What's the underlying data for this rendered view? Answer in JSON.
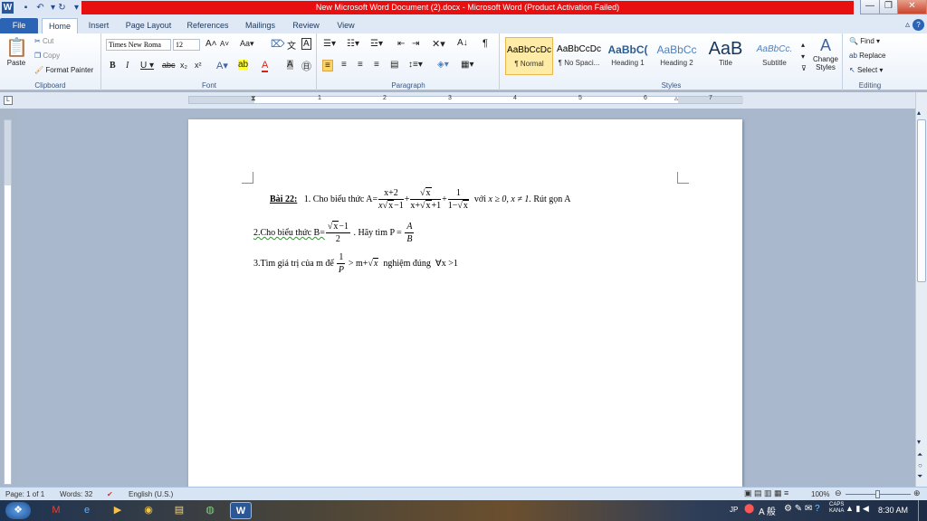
{
  "window": {
    "title": "New Microsoft Word Document (2).docx  -  Microsoft Word (Product Activation Failed)",
    "minimize": "—",
    "restore": "❐",
    "close": "✕"
  },
  "tabs": {
    "file": "File",
    "items": [
      "Home",
      "Insert",
      "Page Layout",
      "References",
      "Mailings",
      "Review",
      "View"
    ],
    "active": "Home"
  },
  "ribbon": {
    "clipboard": {
      "label": "Clipboard",
      "paste": "Paste",
      "cut": "Cut",
      "copy": "Copy",
      "format_painter": "Format Painter"
    },
    "font": {
      "label": "Font",
      "font_name": "Times New Roma",
      "font_size": "12"
    },
    "paragraph": {
      "label": "Paragraph"
    },
    "styles": {
      "label": "Styles",
      "items": [
        {
          "preview": "AaBbCcDc",
          "name": "¶ Normal"
        },
        {
          "preview": "AaBbCcDc",
          "name": "¶ No Spaci..."
        },
        {
          "preview": "AaBbC(",
          "name": "Heading 1"
        },
        {
          "preview": "AaBbCc",
          "name": "Heading 2"
        },
        {
          "preview": "AaB",
          "name": "Title"
        },
        {
          "preview": "AaBbCc.",
          "name": "Subtitle"
        }
      ],
      "change_styles": "Change Styles"
    },
    "editing": {
      "label": "Editing",
      "find": "Find",
      "replace": "Replace",
      "select": "Select"
    }
  },
  "ruler": {
    "numbers": [
      "1",
      "1",
      "2",
      "3",
      "4",
      "5",
      "6",
      "7"
    ]
  },
  "document": {
    "line1": {
      "heading": "Bài 22:",
      "text1": "1. Cho biểu thức A=",
      "f1_num": "x+2",
      "f1_den_a": "x",
      "f1_den_root": "x",
      "f1_den_b": "−1",
      "plus": "+",
      "f2_num_root": "x",
      "f2_den_a": "x+",
      "f2_den_root": "x",
      "f2_den_b": "+1",
      "f3_num": "1",
      "f3_den_a": "1−",
      "f3_den_root": "x",
      "text2": "với",
      "cond": "x ≥ 0, x ≠ 1.",
      "text3": "Rút gọn A"
    },
    "line2": {
      "text1": "2.Cho biểu thức B=",
      "num_root": "x",
      "num_rest": "−1",
      "den": "2",
      "text2": ". Hãy tìm P =",
      "p_num": "A",
      "p_den": "B"
    },
    "line3": {
      "text1": "3.Tìm giá trị của m để",
      "f_num": "1",
      "f_den": "P",
      "text2": "> m+",
      "root": "x",
      "text3": "nghiệm đúng",
      "cond": "∀x >1"
    }
  },
  "status": {
    "page": "Page: 1 of 1",
    "words": "Words: 32",
    "language": "English (U.S.)",
    "zoom": "100%"
  },
  "taskbar": {
    "lang": "JP",
    "ime": "A 般",
    "time": "8:30 AM",
    "caps": "CAPS",
    "kana": "KANA"
  }
}
